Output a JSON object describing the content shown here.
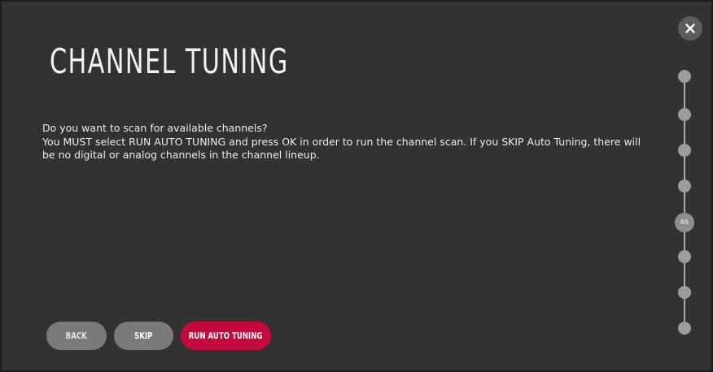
{
  "screen": {
    "title": "CHANNEL TUNING",
    "question": "Do you want to scan for available channels?",
    "instruction": "You MUST select RUN AUTO TUNING and press OK in order to run the channel scan. If you SKIP Auto Tuning, there will be no digital or analog channels in the channel lineup."
  },
  "close": {
    "icon": "close-icon"
  },
  "stepper": {
    "total_steps": 8,
    "current_step": 5,
    "current_label": "05"
  },
  "buttons": {
    "back_label": "BACK",
    "skip_label": "SKIP",
    "run_label": "RUN AUTO TUNING"
  },
  "colors": {
    "background": "#333232",
    "accent": "#c4093d",
    "secondary_button": "#7a7a7a"
  }
}
